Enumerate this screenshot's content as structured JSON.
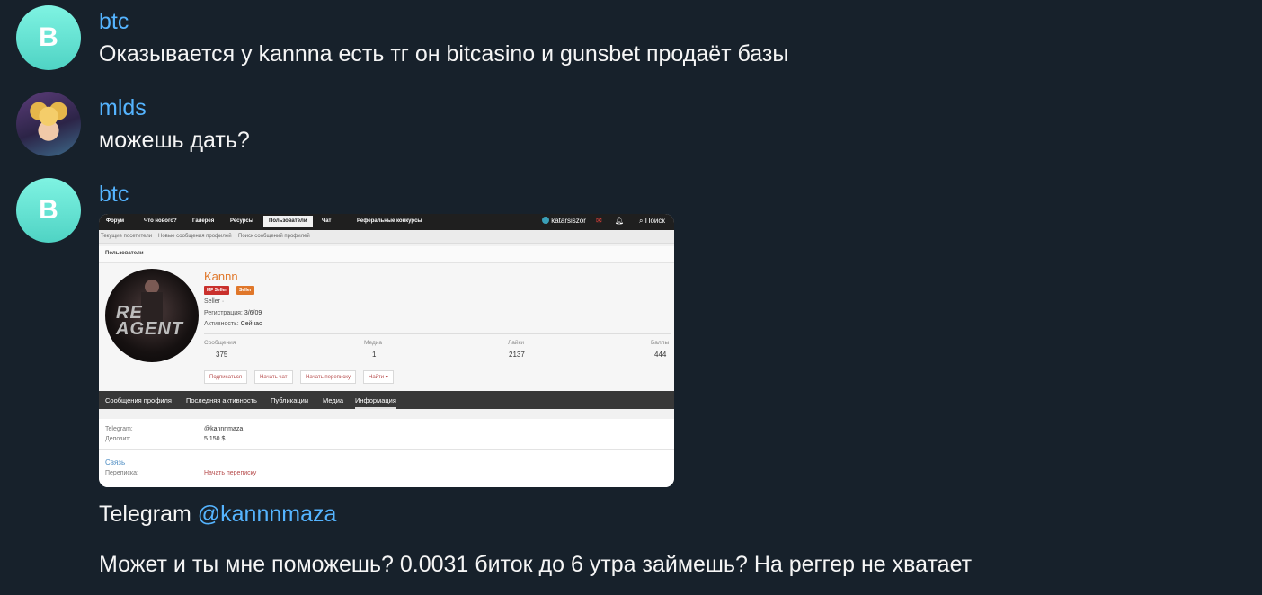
{
  "messages": [
    {
      "sender": "btc",
      "avatar_letter": "B",
      "text": "Оказывается у kannna есть тг он bitcasino и gunsbet продаёт базы"
    },
    {
      "sender": "mlds",
      "text": "можешь дать?"
    },
    {
      "sender": "btc",
      "avatar_letter": "B",
      "caption_prefix": "Telegram ",
      "caption_link": "@kannnmaza",
      "text2": "Может и ты мне поможешь? 0.0031 биток до 6 утра займешь? На реггер не хватает"
    }
  ],
  "screenshot": {
    "nav": [
      "Форум",
      "Что нового?",
      "Галерея",
      "Ресурсы",
      "Пользователи",
      "Чат",
      "Реферальные конкурсы"
    ],
    "nav_user": "katarsiszor",
    "nav_search": "Поиск",
    "subnav": [
      "Текущие посетители",
      "Новые сообщения профилей",
      "Поиск сообщений профилей"
    ],
    "breadcrumb": "Пользователи",
    "profile": {
      "name": "Kannn",
      "badges": [
        "MF Seller",
        "Seller"
      ],
      "avatar_text_1": "RE",
      "avatar_text_2": "AGENT",
      "title": "Seller ·",
      "reg_label": "Регистрация:",
      "reg_value": "3/6/09",
      "act_label": "Активность:",
      "act_value": "Сейчас",
      "stats": [
        {
          "label": "Сообщения",
          "value": "375"
        },
        {
          "label": "Медиа",
          "value": "1"
        },
        {
          "label": "Лайки",
          "value": "2137"
        },
        {
          "label": "Баллы",
          "value": "444"
        }
      ],
      "buttons": [
        "Подписаться",
        "Начать чат",
        "Начать переписку",
        "Найти ▾"
      ]
    },
    "tabs": [
      "Сообщения профиля",
      "Последняя активность",
      "Публикации",
      "Медиа",
      "Информация"
    ],
    "info": {
      "tg_label": "Telegram:",
      "tg_value": "@kannnmaza",
      "dep_label": "Депозит:",
      "dep_value": "5 150 $",
      "contact_head": "Связь",
      "pm_label": "Переписка:",
      "pm_value": "Начать переписку"
    }
  },
  "colors": {
    "background": "#17212b",
    "sender": "#55b4ff",
    "link": "#55b4ff",
    "avatar": "#5fdccb"
  }
}
